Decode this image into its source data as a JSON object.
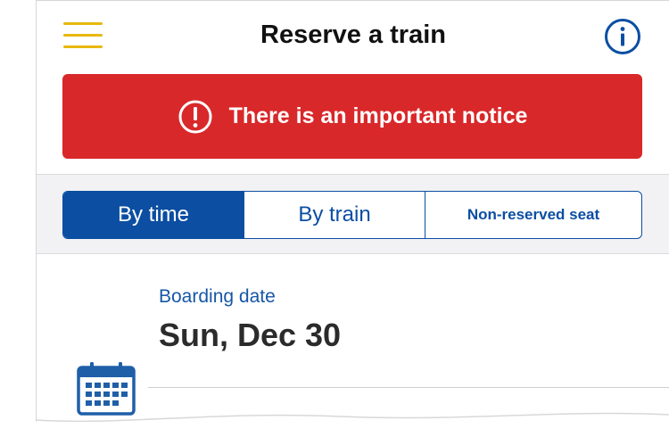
{
  "header": {
    "title": "Reserve a train"
  },
  "notice": {
    "text": "There is an important notice",
    "color": "#d9282a"
  },
  "tabs": [
    {
      "label": "By time",
      "active": true
    },
    {
      "label": "By train",
      "active": false
    },
    {
      "label": "Non-reserved seat",
      "active": false
    }
  ],
  "boarding": {
    "label": "Boarding date",
    "value": "Sun, Dec 30"
  },
  "colors": {
    "accent": "#0b4ea2",
    "menu": "#e8b90d",
    "alert": "#d9282a"
  },
  "icons": [
    "menu-icon",
    "info-icon",
    "alert-icon",
    "calendar-icon"
  ]
}
